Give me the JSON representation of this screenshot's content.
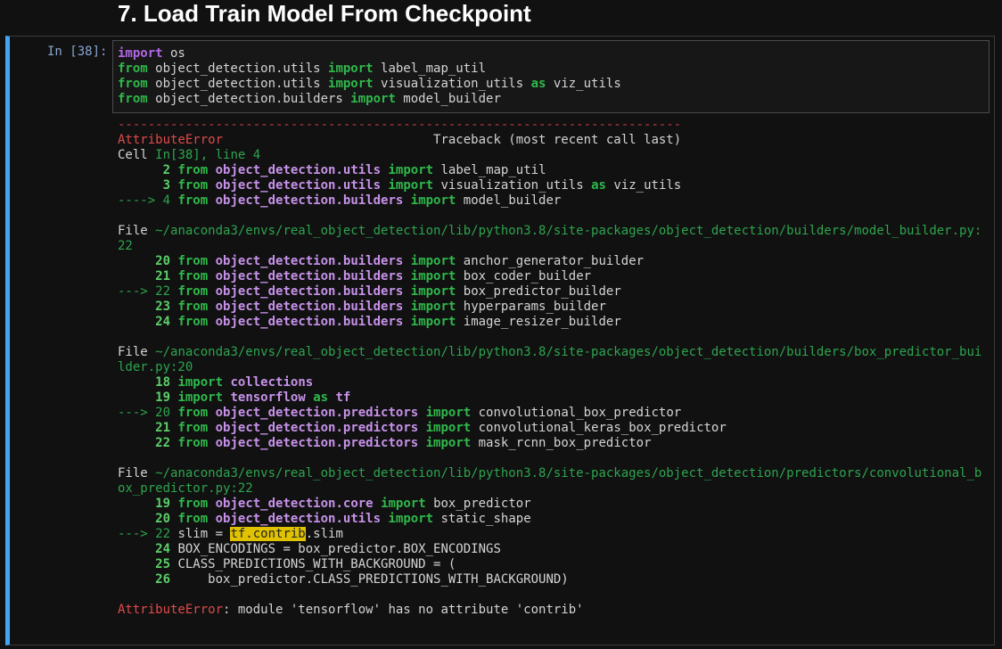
{
  "heading": "7. Load Train Model From Checkpoint",
  "prompt": "In [38]:",
  "input_lines": [
    [
      {
        "t": "import",
        "c": "kwp"
      },
      {
        "t": " os",
        "c": ""
      }
    ],
    [
      {
        "t": "from",
        "c": "kw"
      },
      {
        "t": " object_detection.utils ",
        "c": ""
      },
      {
        "t": "import",
        "c": "kw"
      },
      {
        "t": " label_map_util",
        "c": ""
      }
    ],
    [
      {
        "t": "from",
        "c": "kw"
      },
      {
        "t": " object_detection.utils ",
        "c": ""
      },
      {
        "t": "import",
        "c": "kw"
      },
      {
        "t": " visualization_utils ",
        "c": ""
      },
      {
        "t": "as",
        "c": "kw"
      },
      {
        "t": " viz_utils",
        "c": ""
      }
    ],
    [
      {
        "t": "from",
        "c": "kw"
      },
      {
        "t": " object_detection.builders ",
        "c": ""
      },
      {
        "t": "import",
        "c": "kw"
      },
      {
        "t": " model_builder",
        "c": ""
      }
    ]
  ],
  "output_lines": [
    [
      {
        "t": "---------------------------------------------------------------------------",
        "c": "dash"
      }
    ],
    [
      {
        "t": "AttributeError",
        "c": "err"
      },
      {
        "t": "                            Traceback (most recent call last)",
        "c": ""
      }
    ],
    [
      {
        "t": "Cell ",
        "c": ""
      },
      {
        "t": "In[38], line 4",
        "c": "grn"
      }
    ],
    [
      {
        "t": "      ",
        "c": ""
      },
      {
        "t": "2",
        "c": "ln"
      },
      {
        "t": " ",
        "c": ""
      },
      {
        "t": "from",
        "c": "kw"
      },
      {
        "t": " ",
        "c": ""
      },
      {
        "t": "object_detection.utils",
        "c": "mod"
      },
      {
        "t": " ",
        "c": ""
      },
      {
        "t": "import",
        "c": "kw"
      },
      {
        "t": " label_map_util",
        "c": ""
      }
    ],
    [
      {
        "t": "      ",
        "c": ""
      },
      {
        "t": "3",
        "c": "ln"
      },
      {
        "t": " ",
        "c": ""
      },
      {
        "t": "from",
        "c": "kw"
      },
      {
        "t": " ",
        "c": ""
      },
      {
        "t": "object_detection.utils",
        "c": "mod"
      },
      {
        "t": " ",
        "c": ""
      },
      {
        "t": "import",
        "c": "kw"
      },
      {
        "t": " visualization_utils ",
        "c": ""
      },
      {
        "t": "as",
        "c": "kw"
      },
      {
        "t": " viz_utils",
        "c": ""
      }
    ],
    [
      {
        "t": "----> 4",
        "c": "arrow"
      },
      {
        "t": " ",
        "c": ""
      },
      {
        "t": "from",
        "c": "kw"
      },
      {
        "t": " ",
        "c": ""
      },
      {
        "t": "object_detection.builders",
        "c": "mod"
      },
      {
        "t": " ",
        "c": ""
      },
      {
        "t": "import",
        "c": "kw"
      },
      {
        "t": " model_builder",
        "c": ""
      }
    ],
    [
      {
        "t": "",
        "c": ""
      }
    ],
    [
      {
        "t": "File ",
        "c": ""
      },
      {
        "t": "~/anaconda3/envs/real_object_detection/lib/python3.8/site-packages/object_detection/builders/model_builder.py:",
        "c": "grn"
      }
    ],
    [
      {
        "t": "22",
        "c": "grn"
      }
    ],
    [
      {
        "t": "     ",
        "c": ""
      },
      {
        "t": "20",
        "c": "ln"
      },
      {
        "t": " ",
        "c": ""
      },
      {
        "t": "from",
        "c": "kw"
      },
      {
        "t": " ",
        "c": ""
      },
      {
        "t": "object_detection.builders",
        "c": "mod"
      },
      {
        "t": " ",
        "c": ""
      },
      {
        "t": "import",
        "c": "kw"
      },
      {
        "t": " anchor_generator_builder",
        "c": ""
      }
    ],
    [
      {
        "t": "     ",
        "c": ""
      },
      {
        "t": "21",
        "c": "ln"
      },
      {
        "t": " ",
        "c": ""
      },
      {
        "t": "from",
        "c": "kw"
      },
      {
        "t": " ",
        "c": ""
      },
      {
        "t": "object_detection.builders",
        "c": "mod"
      },
      {
        "t": " ",
        "c": ""
      },
      {
        "t": "import",
        "c": "kw"
      },
      {
        "t": " box_coder_builder",
        "c": ""
      }
    ],
    [
      {
        "t": "---> 22",
        "c": "arrow"
      },
      {
        "t": " ",
        "c": ""
      },
      {
        "t": "from",
        "c": "kw"
      },
      {
        "t": " ",
        "c": ""
      },
      {
        "t": "object_detection.builders",
        "c": "mod"
      },
      {
        "t": " ",
        "c": ""
      },
      {
        "t": "import",
        "c": "kw"
      },
      {
        "t": " box_predictor_builder",
        "c": ""
      }
    ],
    [
      {
        "t": "     ",
        "c": ""
      },
      {
        "t": "23",
        "c": "ln"
      },
      {
        "t": " ",
        "c": ""
      },
      {
        "t": "from",
        "c": "kw"
      },
      {
        "t": " ",
        "c": ""
      },
      {
        "t": "object_detection.builders",
        "c": "mod"
      },
      {
        "t": " ",
        "c": ""
      },
      {
        "t": "import",
        "c": "kw"
      },
      {
        "t": " hyperparams_builder",
        "c": ""
      }
    ],
    [
      {
        "t": "     ",
        "c": ""
      },
      {
        "t": "24",
        "c": "ln"
      },
      {
        "t": " ",
        "c": ""
      },
      {
        "t": "from",
        "c": "kw"
      },
      {
        "t": " ",
        "c": ""
      },
      {
        "t": "object_detection.builders",
        "c": "mod"
      },
      {
        "t": " ",
        "c": ""
      },
      {
        "t": "import",
        "c": "kw"
      },
      {
        "t": " image_resizer_builder",
        "c": ""
      }
    ],
    [
      {
        "t": "",
        "c": ""
      }
    ],
    [
      {
        "t": "File ",
        "c": ""
      },
      {
        "t": "~/anaconda3/envs/real_object_detection/lib/python3.8/site-packages/object_detection/builders/box_predictor_bui",
        "c": "grn"
      }
    ],
    [
      {
        "t": "lder.py:20",
        "c": "grn"
      }
    ],
    [
      {
        "t": "     ",
        "c": ""
      },
      {
        "t": "18",
        "c": "ln"
      },
      {
        "t": " ",
        "c": ""
      },
      {
        "t": "import",
        "c": "kw"
      },
      {
        "t": " ",
        "c": ""
      },
      {
        "t": "collections",
        "c": "mod"
      }
    ],
    [
      {
        "t": "     ",
        "c": ""
      },
      {
        "t": "19",
        "c": "ln"
      },
      {
        "t": " ",
        "c": ""
      },
      {
        "t": "import",
        "c": "kw"
      },
      {
        "t": " ",
        "c": ""
      },
      {
        "t": "tensorflow",
        "c": "mod"
      },
      {
        "t": " ",
        "c": ""
      },
      {
        "t": "as",
        "c": "kw"
      },
      {
        "t": " ",
        "c": ""
      },
      {
        "t": "tf",
        "c": "mod"
      }
    ],
    [
      {
        "t": "---> 20",
        "c": "arrow"
      },
      {
        "t": " ",
        "c": ""
      },
      {
        "t": "from",
        "c": "kw"
      },
      {
        "t": " ",
        "c": ""
      },
      {
        "t": "object_detection.predictors",
        "c": "mod"
      },
      {
        "t": " ",
        "c": ""
      },
      {
        "t": "import",
        "c": "kw"
      },
      {
        "t": " convolutional_box_predictor",
        "c": ""
      }
    ],
    [
      {
        "t": "     ",
        "c": ""
      },
      {
        "t": "21",
        "c": "ln"
      },
      {
        "t": " ",
        "c": ""
      },
      {
        "t": "from",
        "c": "kw"
      },
      {
        "t": " ",
        "c": ""
      },
      {
        "t": "object_detection.predictors",
        "c": "mod"
      },
      {
        "t": " ",
        "c": ""
      },
      {
        "t": "import",
        "c": "kw"
      },
      {
        "t": " convolutional_keras_box_predictor",
        "c": ""
      }
    ],
    [
      {
        "t": "     ",
        "c": ""
      },
      {
        "t": "22",
        "c": "ln"
      },
      {
        "t": " ",
        "c": ""
      },
      {
        "t": "from",
        "c": "kw"
      },
      {
        "t": " ",
        "c": ""
      },
      {
        "t": "object_detection.predictors",
        "c": "mod"
      },
      {
        "t": " ",
        "c": ""
      },
      {
        "t": "import",
        "c": "kw"
      },
      {
        "t": " mask_rcnn_box_predictor",
        "c": ""
      }
    ],
    [
      {
        "t": "",
        "c": ""
      }
    ],
    [
      {
        "t": "File ",
        "c": ""
      },
      {
        "t": "~/anaconda3/envs/real_object_detection/lib/python3.8/site-packages/object_detection/predictors/convolutional_b",
        "c": "grn"
      }
    ],
    [
      {
        "t": "ox_predictor.py:22",
        "c": "grn"
      }
    ],
    [
      {
        "t": "     ",
        "c": ""
      },
      {
        "t": "19",
        "c": "ln"
      },
      {
        "t": " ",
        "c": ""
      },
      {
        "t": "from",
        "c": "kw"
      },
      {
        "t": " ",
        "c": ""
      },
      {
        "t": "object_detection.core",
        "c": "mod"
      },
      {
        "t": " ",
        "c": ""
      },
      {
        "t": "import",
        "c": "kw"
      },
      {
        "t": " box_predictor",
        "c": ""
      }
    ],
    [
      {
        "t": "     ",
        "c": ""
      },
      {
        "t": "20",
        "c": "ln"
      },
      {
        "t": " ",
        "c": ""
      },
      {
        "t": "from",
        "c": "kw"
      },
      {
        "t": " ",
        "c": ""
      },
      {
        "t": "object_detection.utils",
        "c": "mod"
      },
      {
        "t": " ",
        "c": ""
      },
      {
        "t": "import",
        "c": "kw"
      },
      {
        "t": " static_shape",
        "c": ""
      }
    ],
    [
      {
        "t": "---> 22",
        "c": "arrow"
      },
      {
        "t": " slim = ",
        "c": ""
      },
      {
        "t": "tf.contrib",
        "c": "hl"
      },
      {
        "t": ".slim",
        "c": ""
      }
    ],
    [
      {
        "t": "     ",
        "c": ""
      },
      {
        "t": "24",
        "c": "ln"
      },
      {
        "t": " BOX_ENCODINGS = box_predictor.BOX_ENCODINGS",
        "c": ""
      }
    ],
    [
      {
        "t": "     ",
        "c": ""
      },
      {
        "t": "25",
        "c": "ln"
      },
      {
        "t": " CLASS_PREDICTIONS_WITH_BACKGROUND = (",
        "c": ""
      }
    ],
    [
      {
        "t": "     ",
        "c": ""
      },
      {
        "t": "26",
        "c": "ln"
      },
      {
        "t": "     box_predictor.CLASS_PREDICTIONS_WITH_BACKGROUND)",
        "c": ""
      }
    ],
    [
      {
        "t": "",
        "c": ""
      }
    ],
    [
      {
        "t": "AttributeError",
        "c": "err"
      },
      {
        "t": ": module 'tensorflow' has no attribute 'contrib'",
        "c": ""
      }
    ]
  ]
}
